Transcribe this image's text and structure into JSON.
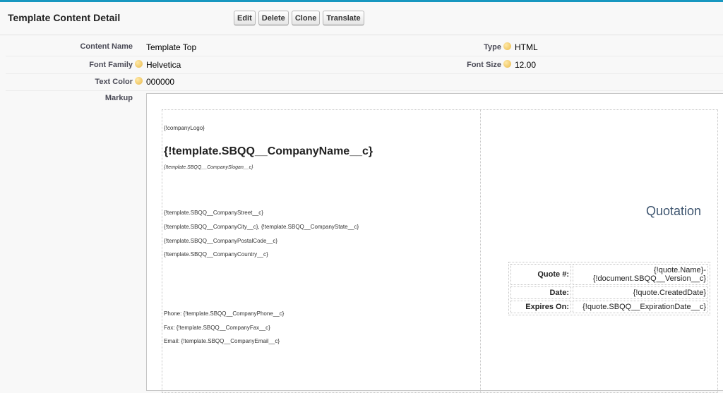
{
  "header": {
    "title": "Template Content Detail",
    "buttons": [
      "Edit",
      "Delete",
      "Clone",
      "Translate"
    ]
  },
  "fields": {
    "content_name": {
      "label": "Content Name",
      "value": "Template Top"
    },
    "type": {
      "label": "Type",
      "value": "HTML"
    },
    "font_family": {
      "label": "Font Family",
      "value": "Helvetica"
    },
    "font_size": {
      "label": "Font Size",
      "value": "12.00"
    },
    "text_color": {
      "label": "Text Color",
      "value": "000000"
    },
    "markup": {
      "label": "Markup"
    }
  },
  "preview": {
    "logo": "{!companyLogo}",
    "company_name": "{!template.SBQQ__CompanyName__c}",
    "slogan": "{!template.SBQQ__CompanySlogan__c}",
    "street": "{!template.SBQQ__CompanyStreet__c}",
    "city_state": "{!template.SBQQ__CompanyCity__c}, {!template.SBQQ__CompanyState__c}",
    "postal": "{!template.SBQQ__CompanyPostalCode__c}",
    "country": "{!template.SBQQ__CompanyCountry__c}",
    "phone": "Phone: {!template.SBQQ__CompanyPhone__c}",
    "fax": "Fax: {!template.SBQQ__CompanyFax__c}",
    "email": "Email: {!template.SBQQ__CompanyEmail__c}",
    "quotation": "Quotation",
    "quote_table": [
      {
        "label": "Quote #:",
        "value_line1": "{!quote.Name}-",
        "value_line2": "{!document.SBQQ__Version__c}"
      },
      {
        "label": "Date:",
        "value_line1": "{!quote.CreatedDate}"
      },
      {
        "label": "Expires On:",
        "value_line1": "{!quote.SBQQ__ExpirationDate__c}"
      }
    ]
  }
}
